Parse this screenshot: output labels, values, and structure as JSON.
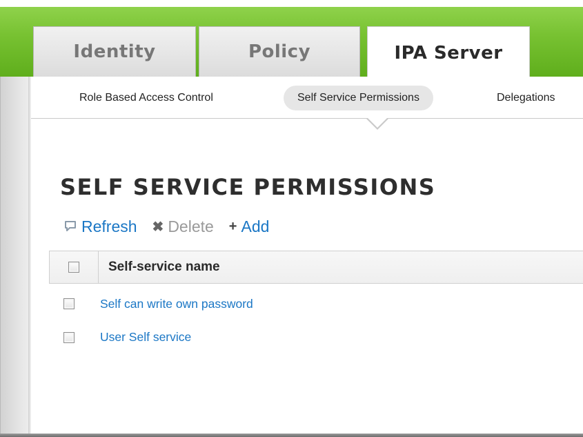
{
  "tabs": [
    {
      "label": "Identity",
      "active": false
    },
    {
      "label": "Policy",
      "active": false
    },
    {
      "label": "IPA Server",
      "active": true
    }
  ],
  "subnav": {
    "items": [
      {
        "label": "Role Based Access Control",
        "selected": false
      },
      {
        "label": "Self Service Permissions",
        "selected": true
      },
      {
        "label": "Delegations",
        "selected": false
      }
    ]
  },
  "page": {
    "title": "SELF SERVICE PERMISSIONS"
  },
  "actions": {
    "refresh": {
      "label": "Refresh",
      "icon": "refresh-icon",
      "enabled": true
    },
    "delete": {
      "label": "Delete",
      "icon": "x-icon",
      "enabled": false
    },
    "add": {
      "label": "Add",
      "icon": "plus-icon",
      "enabled": true
    }
  },
  "table": {
    "columns": [
      "Self-service name"
    ],
    "rows": [
      {
        "name": "Self can write own password",
        "checked": false
      },
      {
        "name": "User Self service",
        "checked": false
      }
    ]
  },
  "colors": {
    "header_green": "#78c232",
    "link_blue": "#1b77c5",
    "selected_pill": "#e6e6e6"
  }
}
